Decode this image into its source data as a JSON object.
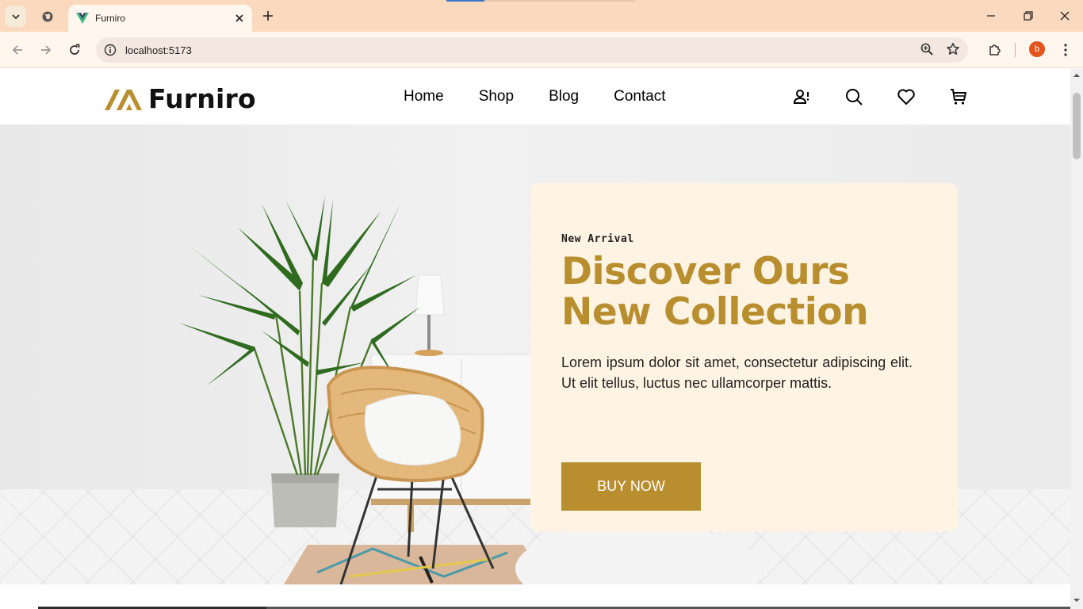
{
  "browser": {
    "tab_title": "Furniro",
    "url": "localhost:5173",
    "profile_initial": "b"
  },
  "site": {
    "logo_text": "Furniro",
    "nav": [
      {
        "label": "Home"
      },
      {
        "label": "Shop"
      },
      {
        "label": "Blog"
      },
      {
        "label": "Contact"
      }
    ],
    "header_icons": [
      "account-icon",
      "search-icon",
      "heart-icon",
      "cart-icon"
    ]
  },
  "hero": {
    "eyebrow": "New Arrival",
    "title": "Discover Ours New Collection",
    "body": "Lorem ipsum dolor sit amet, consectetur adipiscing elit. Ut elit tellus, luctus nec ullamcorper mattis.",
    "cta": "BUY NOW"
  },
  "colors": {
    "accent": "#b88e2f",
    "card_bg": "#fff3e3",
    "tabbar_bg": "#fbd9bf",
    "profile": "#e4531c"
  }
}
